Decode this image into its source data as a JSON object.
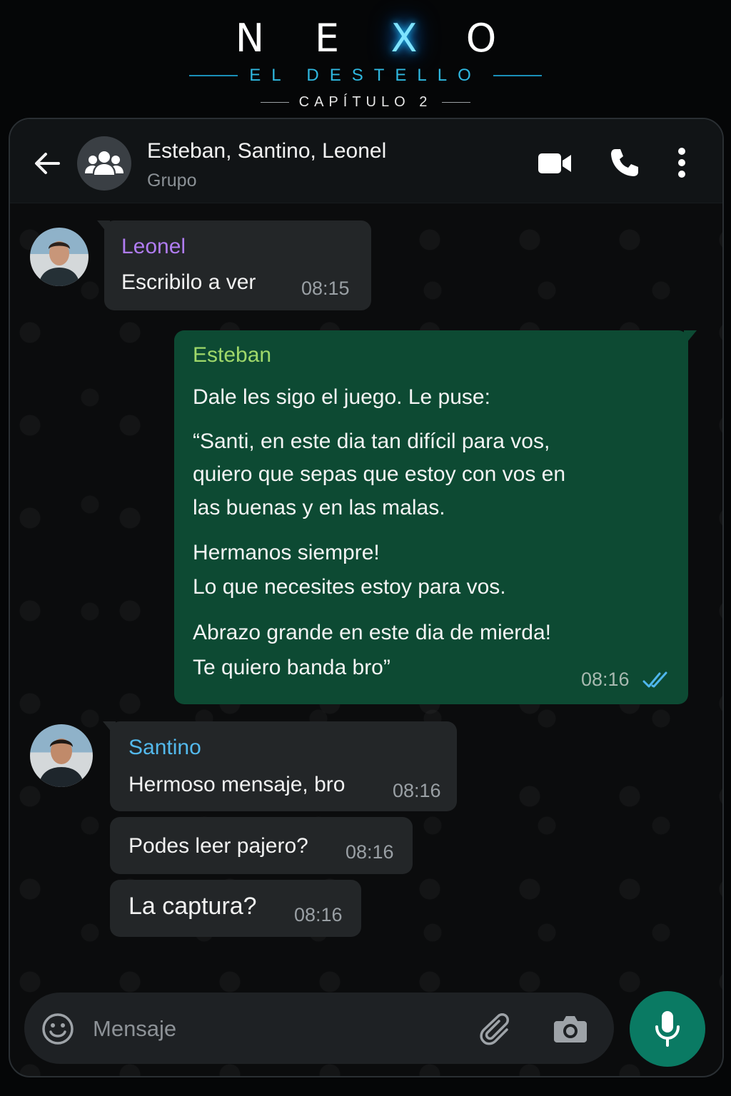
{
  "brand": {
    "logo_letters": [
      "N",
      "E",
      "X",
      "O"
    ],
    "subtitle": "EL DESTELLO",
    "chapter": "CAPÍTULO 2"
  },
  "header": {
    "title": "Esteban, Santino, Leonel",
    "subtitle": "Grupo",
    "icons": [
      "back-arrow-icon",
      "group-icon",
      "video-icon",
      "phone-icon",
      "more-vertical-icon"
    ]
  },
  "messages": [
    {
      "sender": "Leonel",
      "sender_color": "#b07cf2",
      "text": "Escribilo a ver",
      "time": "08:15"
    },
    {
      "sender": "Esteban",
      "sender_color": "#9fd86a",
      "lines": [
        "Dale les sigo el juego. Le puse:",
        "“Santi, en este dia tan difícil para vos,",
        "quiero que sepas que estoy con vos en",
        "las buenas y en las malas.",
        "Hermanos siempre!",
        "Lo que necesites estoy para vos.",
        "Abrazo grande en este dia de mierda!",
        "Te quiero banda bro”"
      ],
      "time": "08:16",
      "status": "read"
    },
    {
      "sender": "Santino",
      "sender_color": "#53b9ec",
      "text": "Hermoso mensaje, bro",
      "time": "08:16"
    },
    {
      "text": "Podes leer pajero?",
      "time": "08:16"
    },
    {
      "text": "La captura?",
      "time": "08:16"
    }
  ],
  "composer": {
    "placeholder": "Mensaje",
    "accent": "#0a7a63"
  },
  "colors": {
    "background": "#050607",
    "outgoing_bubble": "#0d4a33",
    "incoming_bubble": "#232628",
    "read_ticks": "#4fb6ec"
  }
}
